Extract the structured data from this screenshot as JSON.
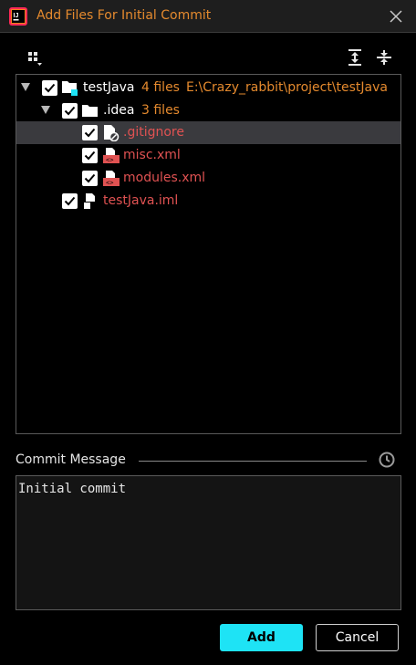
{
  "window": {
    "title": "Add Files For Initial Commit",
    "app_icon": "intellij-icon",
    "accent_color": "#e58a2e",
    "close_icon": "close-icon"
  },
  "toolbar": {
    "group_by_icon": "group-by-icon",
    "expand_all_icon": "expand-all-icon",
    "collapse_all_icon": "collapse-all-icon"
  },
  "tree": {
    "root": {
      "label": "testJava",
      "count": "4 files",
      "path": "E:\\Crazy_rabbit\\project\\testJava",
      "checked": true,
      "expanded": true
    },
    "idea_folder": {
      "label": ".idea",
      "count": "3 files",
      "checked": true,
      "expanded": true
    },
    "files": [
      {
        "label": ".gitignore",
        "checked": true,
        "icon": "ignore-file-icon",
        "selected": true
      },
      {
        "label": "misc.xml",
        "checked": true,
        "icon": "xml-file-icon",
        "selected": false
      },
      {
        "label": "modules.xml",
        "checked": true,
        "icon": "xml-file-icon",
        "selected": false
      },
      {
        "label": "testJava.iml",
        "checked": true,
        "icon": "iml-file-icon",
        "selected": false
      }
    ]
  },
  "commit": {
    "label": "Commit Message",
    "message": "Initial commit",
    "history_icon": "history-icon"
  },
  "buttons": {
    "add": "Add",
    "cancel": "Cancel",
    "add_color": "#1ee3f5"
  }
}
